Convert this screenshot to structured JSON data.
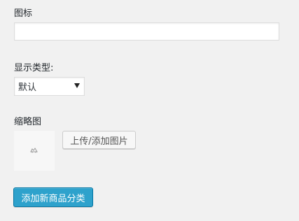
{
  "form": {
    "icon_label": "图标",
    "icon_value": "",
    "display_type_label": "显示类型:",
    "display_type_selected": "默认",
    "thumbnail_label": "缩略图",
    "upload_button_label": "上传/添加图片",
    "submit_button_label": "添加新商品分类"
  },
  "colors": {
    "primary_button": "#2ea2cc",
    "page_background": "#f1f1f1"
  },
  "icons": {
    "thumbnail_placeholder": "image-placeholder-icon",
    "select_caret": "caret-down-icon"
  }
}
